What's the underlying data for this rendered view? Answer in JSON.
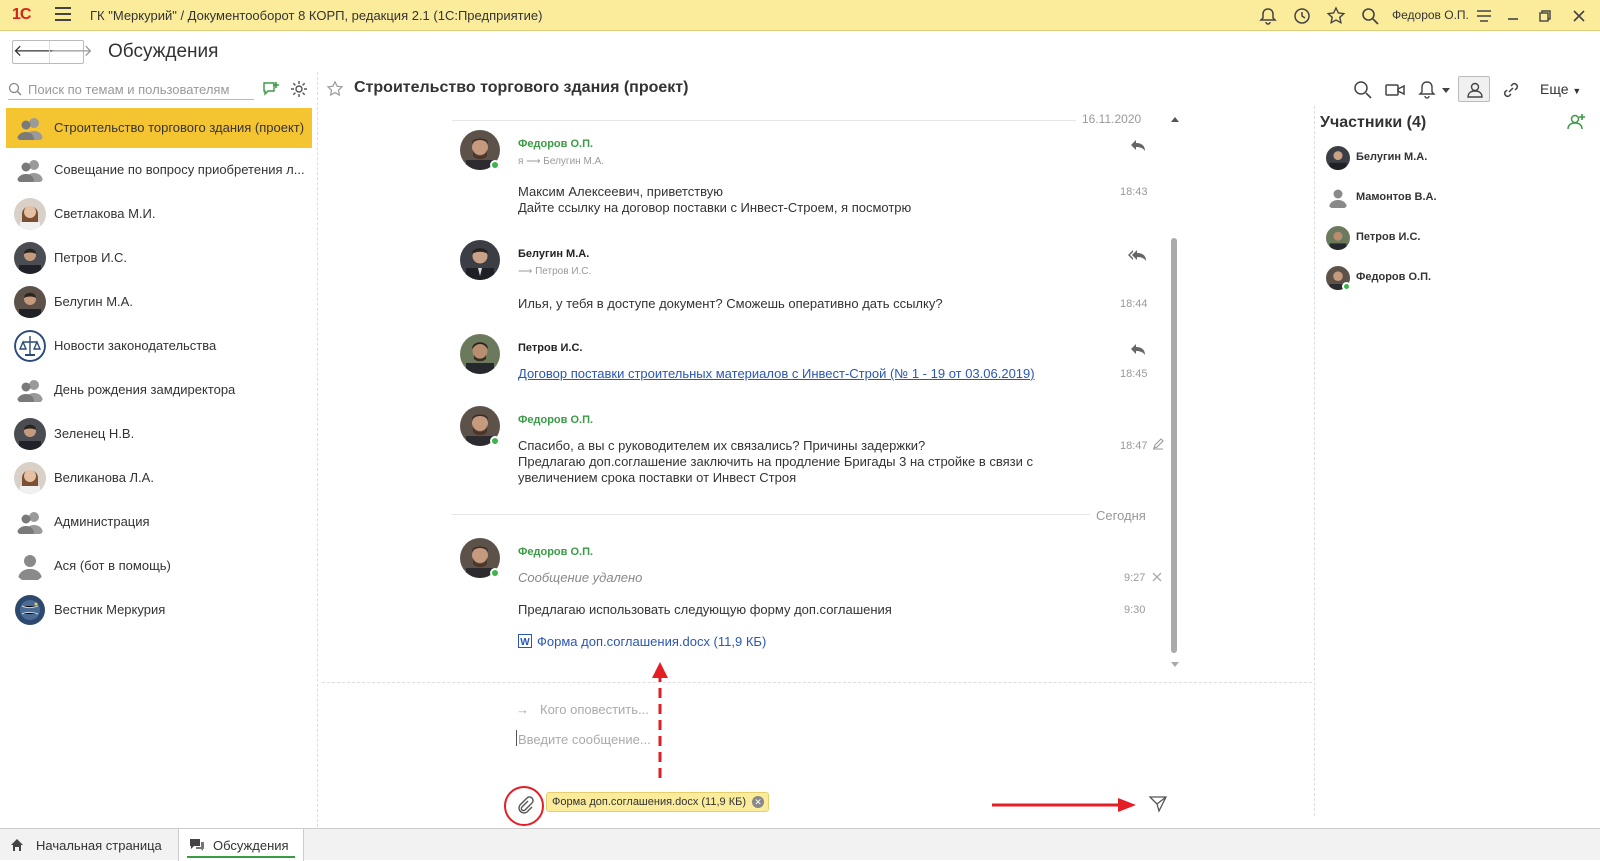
{
  "window": {
    "logo": "1С",
    "title": "ГК \"Меркурий\" / Документооборот 8 КОРП, редакция 2.1  (1С:Предприятие)",
    "user": "Федоров О.П."
  },
  "header": {
    "back_label": "🡐",
    "forward_label": "🡒",
    "page_title": "Обсуждения"
  },
  "search": {
    "placeholder": "Поиск по темам и пользователям"
  },
  "chats": [
    {
      "label": "Строительство торгового здания (проект)",
      "avatar": "group-icon",
      "active": true
    },
    {
      "label": "Совещание по вопросу приобретения л...",
      "avatar": "group-icon"
    },
    {
      "label": "Светлакова М.И.",
      "avatar": "woman-photo"
    },
    {
      "label": "Петров И.С.",
      "avatar": "man-photo"
    },
    {
      "label": "Белугин М.А.",
      "avatar": "man-photo"
    },
    {
      "label": "Новости законодательства",
      "avatar": "emblem-icon"
    },
    {
      "label": "День рождения замдиректора",
      "avatar": "group-icon"
    },
    {
      "label": "Зеленец Н.В.",
      "avatar": "man-photo"
    },
    {
      "label": "Великанова Л.А.",
      "avatar": "woman-photo"
    },
    {
      "label": "Администрация",
      "avatar": "group-icon"
    },
    {
      "label": "Ася (бот в помощь)",
      "avatar": "person-icon"
    },
    {
      "label": "Вестник Меркурия",
      "avatar": "globe-icon"
    }
  ],
  "chat": {
    "title": "Строительство торгового здания (проект)",
    "more_label": "Еще",
    "date_1": "16.11.2020",
    "date_2": "Сегодня",
    "messages": [
      {
        "author": "Федоров О.П.",
        "route": "я ⟶ Белугин М.А.",
        "text": "Максим Алексеевич, приветствую\nДайте ссылку на договор поставки с Инвест-Строем, я посмотрю",
        "time": "18:43"
      },
      {
        "author": "Белугин М.А.",
        "route": "⟶ Петров И.С.",
        "text": "Илья, у тебя в доступе документ? Сможешь оперативно дать ссылку?",
        "time": "18:44"
      },
      {
        "author": "Петров И.С.",
        "link": "Договор поставки строительных материалов с Инвест-Строй (№ 1 - 19 от 03.06.2019)",
        "time": "18:45"
      },
      {
        "author": "Федоров О.П.",
        "text": "Спасибо, а вы с руководителем их связались? Причины задержки?\nПредлагаю доп.соглашение заключить на продление Бригады 3 на стройке в связи с\nувеличением срока поставки от Инвест Строя",
        "time": "18:47"
      },
      {
        "author": "Федоров О.П.",
        "deleted": "Сообщение удалено",
        "time": "9:27",
        "text": "Предлагаю использовать следующую форму доп.соглашения",
        "time_2": "9:30",
        "file": "Форма доп.соглашения.docx (11,9 КБ)"
      }
    ]
  },
  "composer": {
    "notify_placeholder": "Кого оповестить...",
    "message_placeholder": "Введите сообщение...",
    "attachment_chip": "Форма доп.соглашения.docx (11,9 КБ)"
  },
  "participants": {
    "title": "Участники (4)",
    "list": [
      {
        "name": "Белугин М.А.",
        "online": false
      },
      {
        "name": "Мамонтов В.А.",
        "online": false
      },
      {
        "name": "Петров И.С.",
        "online": false
      },
      {
        "name": "Федоров О.П.",
        "online": true
      }
    ]
  },
  "bottom_tabs": [
    {
      "label": "Начальная страница",
      "icon": "home-icon"
    },
    {
      "label": "Обсуждения",
      "icon": "chat-icon",
      "active": true
    }
  ],
  "colors": {
    "accent": "#f5c531",
    "titlebar": "#fbec9c",
    "author_green": "#3a9b45",
    "link": "#2a56b6",
    "annotation_red": "#e31e24"
  }
}
